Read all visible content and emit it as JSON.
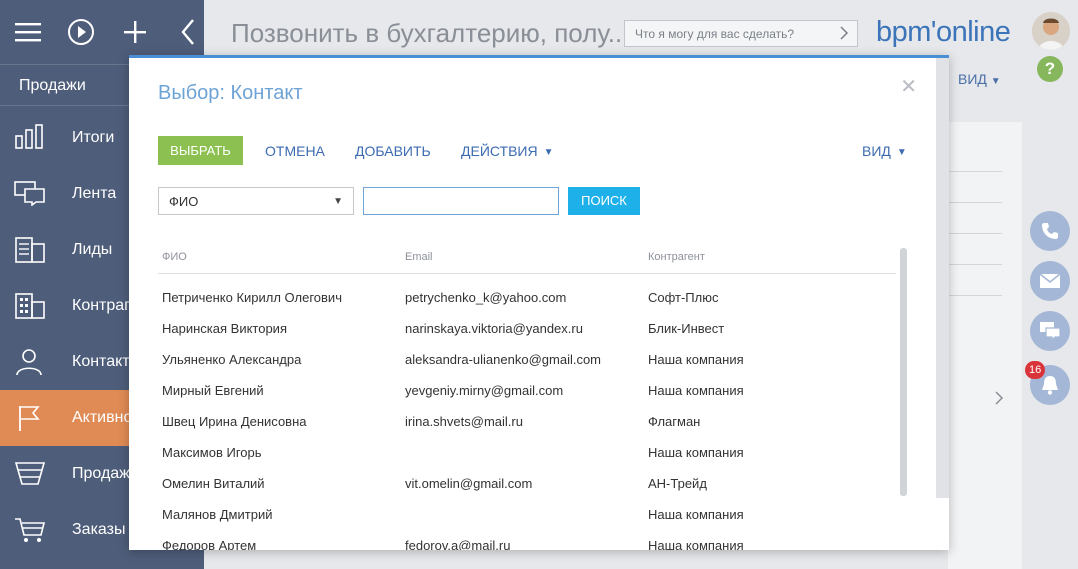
{
  "sidebar": {
    "section_title": "Продажи",
    "items": [
      {
        "label": "Итоги",
        "icon": "chart-icon",
        "active": false
      },
      {
        "label": "Лента",
        "icon": "feed-icon",
        "active": false
      },
      {
        "label": "Лиды",
        "icon": "leads-icon",
        "active": false
      },
      {
        "label": "Контрагенты",
        "icon": "building-icon",
        "active": false
      },
      {
        "label": "Контакты",
        "icon": "person-icon",
        "active": false
      },
      {
        "label": "Активности",
        "icon": "flag-icon",
        "active": true
      },
      {
        "label": "Продажи",
        "icon": "funnel-icon",
        "active": false
      },
      {
        "label": "Заказы",
        "icon": "cart-icon",
        "active": false
      }
    ]
  },
  "header": {
    "page_title": "Позвонить в бухгалтерию, полу...",
    "assistant_placeholder": "Что я могу для вас сделать?",
    "logo": "bpm'online"
  },
  "background": {
    "view_label": "ВИД",
    "notification_count": "16"
  },
  "modal": {
    "title": "Выбор: Контакт",
    "buttons": {
      "select": "ВЫБРАТЬ",
      "cancel": "ОТМЕНА",
      "add": "ДОБАВИТЬ",
      "actions": "ДЕЙСТВИЯ",
      "view": "ВИД",
      "search": "ПОИСК"
    },
    "filter": {
      "field": "ФИО",
      "value": ""
    },
    "columns": [
      "ФИО",
      "Email",
      "Контрагент"
    ],
    "rows": [
      [
        "Петриченко Кирилл Олегович",
        "petrychenko_k@yahoo.com",
        "Софт-Плюс"
      ],
      [
        "Наринская Виктория",
        "narinskaya.viktoria@yandex.ru",
        "Блик-Инвест"
      ],
      [
        "Ульяненко Александра",
        "aleksandra-ulianenko@gmail.com",
        "Наша компания"
      ],
      [
        "Мирный Евгений",
        "yevgeniy.mirny@gmail.com",
        "Наша компания"
      ],
      [
        "Швец Ирина Денисовна",
        "irina.shvets@mail.ru",
        "Флагман"
      ],
      [
        "Максимов Игорь",
        "",
        "Наша компания"
      ],
      [
        "Омелин Виталий",
        "vit.omelin@gmail.com",
        "АН-Трейд"
      ],
      [
        "Малянов Дмитрий",
        "",
        "Наша компания"
      ],
      [
        "Федоров Артем",
        "fedorov.a@mail.ru",
        "Наша компания"
      ]
    ]
  }
}
